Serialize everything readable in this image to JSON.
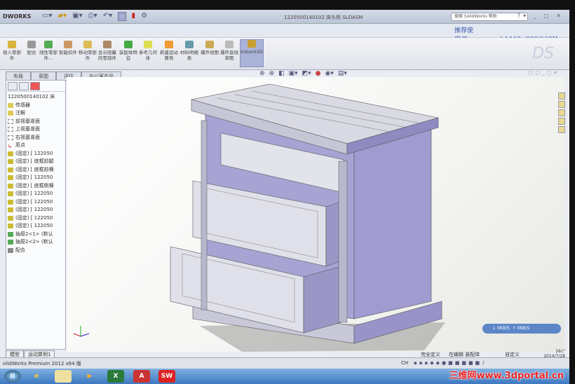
{
  "window": {
    "app_logo": "DWORKS",
    "document_title": "1220500140102 床头柜.SLDASM",
    "search_placeholder": "搜索 SolidWorks 帮助",
    "recommend": "推荐使用/Recommend:1440×900@60Hz"
  },
  "ribbon": {
    "buttons": [
      "插入零部件",
      "配合",
      "线性零部件...",
      "智能扣件",
      "移动零部件",
      "显示隐藏的零部件",
      "装配体特征",
      "参考几何体",
      "新建运动算例",
      "材料明细表",
      "爆炸视图",
      "爆炸直线草图",
      "Instant3D"
    ]
  },
  "tabs": [
    "布局",
    "草图",
    "评估",
    "办公室产品"
  ],
  "tree": {
    "root": "1220500140102 床",
    "items": [
      {
        "label": "传感器",
        "icon": "sensor"
      },
      {
        "label": "注解",
        "icon": "annotation"
      },
      {
        "label": "前视基准面",
        "icon": "plane"
      },
      {
        "label": "上视基准面",
        "icon": "plane"
      },
      {
        "label": "右视基准面",
        "icon": "plane"
      },
      {
        "label": "原点",
        "icon": "origin"
      },
      {
        "label": "(固定) [ 122050",
        "icon": "part"
      },
      {
        "label": "(固定) [ 底框前腿",
        "icon": "part"
      },
      {
        "label": "(固定) [ 底框前横",
        "icon": "part"
      },
      {
        "label": "(固定) [ 122050",
        "icon": "part"
      },
      {
        "label": "(固定) [ 底框侧横",
        "icon": "part"
      },
      {
        "label": "(固定) [ 122050",
        "icon": "part"
      },
      {
        "label": "(固定) [ 122050",
        "icon": "part"
      },
      {
        "label": "(固定) [ 122050",
        "icon": "part"
      },
      {
        "label": "(固定) [ 122050",
        "icon": "part"
      },
      {
        "label": "(固定) [ 122050",
        "icon": "part"
      },
      {
        "label": "抽屉2<1> (默认",
        "icon": "part"
      },
      {
        "label": "抽屉2<2> (默认",
        "icon": "part"
      },
      {
        "label": "配合",
        "icon": "mate"
      }
    ]
  },
  "bottom_tabs": [
    "模型",
    "运动算例1"
  ],
  "status": {
    "app": "olidWorks Premium 2012 x64 版",
    "state": "完全定义",
    "editing": "在编辑 装配体",
    "custom": "自定义",
    "net_down": "0KB/S",
    "net_up": "0KB/S",
    "cpu": "16c°",
    "date": "2014/7/28",
    "lang": "CH"
  },
  "taskbar": [
    "IE",
    "Explorer",
    "Media",
    "Excel",
    "Acrobat",
    "SolidWorks"
  ],
  "watermark": "三维网www.3dportal.cn"
}
